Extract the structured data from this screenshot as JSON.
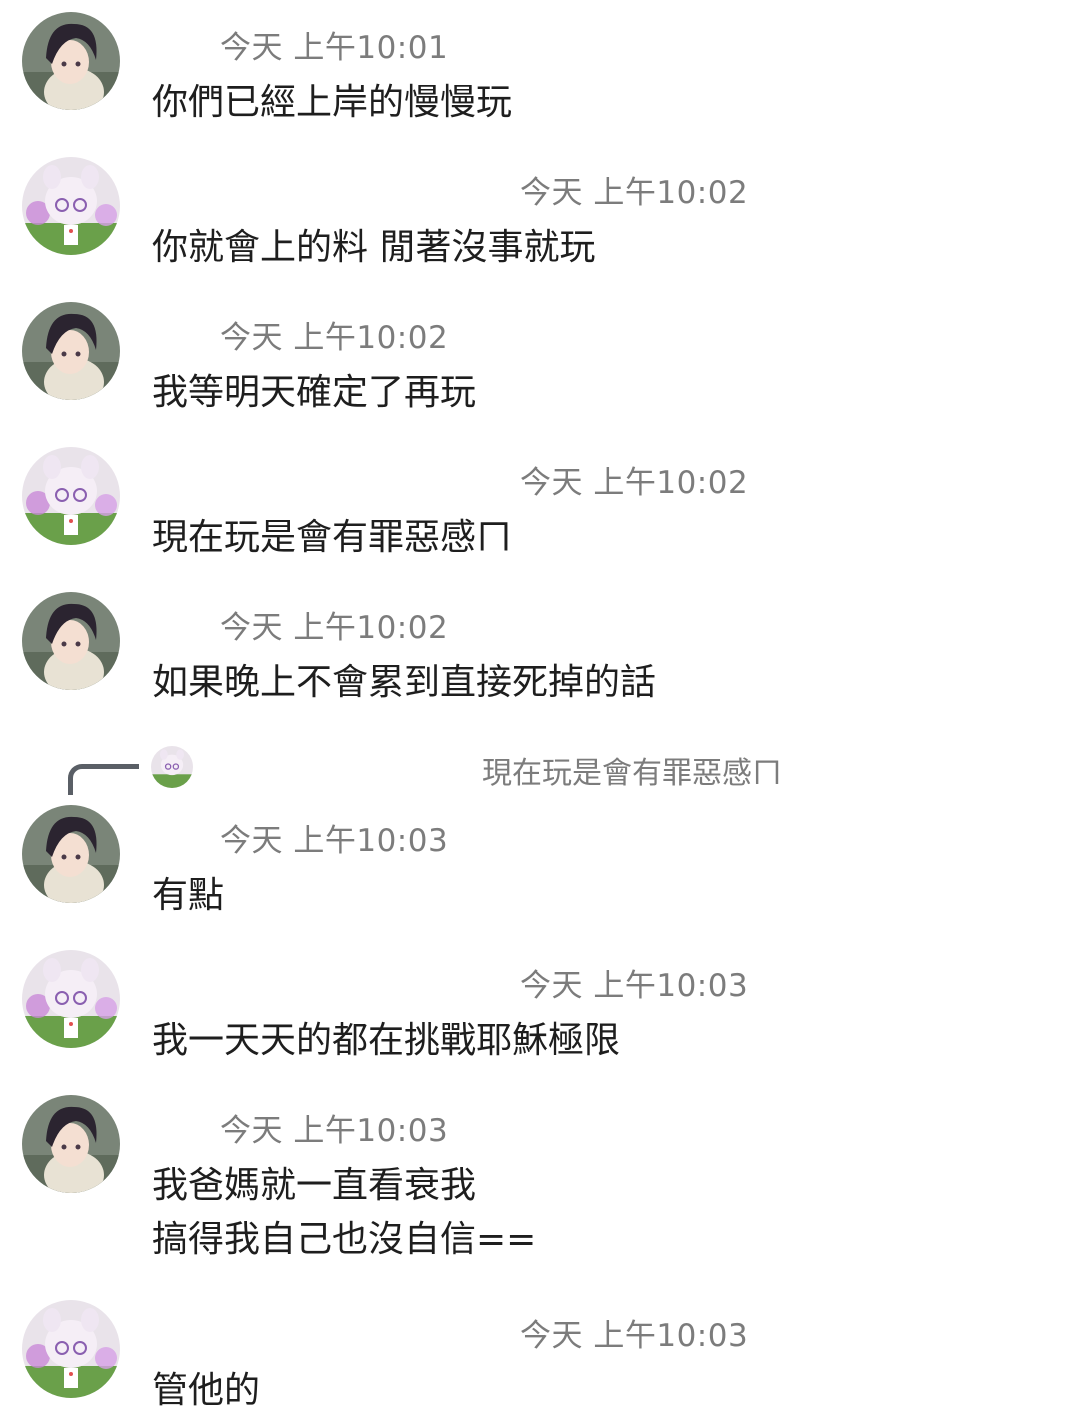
{
  "messages": [
    {
      "user": "boy",
      "time": "今天 上午10:01",
      "lines": [
        "你們已經上岸的慢慢玩"
      ]
    },
    {
      "user": "girl",
      "time": "今天 上午10:02",
      "lines": [
        "你就會上的料 閒著沒事就玩"
      ]
    },
    {
      "user": "boy",
      "time": "今天 上午10:02",
      "lines": [
        "我等明天確定了再玩"
      ]
    },
    {
      "user": "girl",
      "time": "今天 上午10:02",
      "lines": [
        "現在玩是會有罪惡感ㄇ"
      ]
    },
    {
      "user": "boy",
      "time": "今天 上午10:02",
      "lines": [
        "如果晚上不會累到直接死掉的話"
      ]
    },
    {
      "user": "boy",
      "time": "今天 上午10:03",
      "lines": [
        "有點"
      ]
    },
    {
      "user": "girl",
      "time": "今天 上午10:03",
      "lines": [
        "我一天天的都在挑戰耶穌極限"
      ]
    },
    {
      "user": "boy",
      "time": "今天 上午10:03",
      "lines": [
        "我爸媽就一直看衰我",
        "搞得我自己也沒自信=="
      ]
    },
    {
      "user": "girl",
      "time": "今天 上午10:03",
      "lines": [
        "管他的"
      ]
    }
  ],
  "reply_quote": {
    "avatar_icon": "girl-avatar-icon",
    "text": "現在玩是會有罪惡感ㄇ"
  },
  "colors": {
    "timestamp": "#7c7c7c",
    "text": "#1e1e1e",
    "quote_line": "#5a5f66",
    "background": "#ffffff"
  }
}
